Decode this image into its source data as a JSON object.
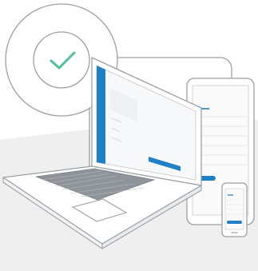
{
  "illustration": {
    "status": {
      "icon": "check-icon",
      "state": "success"
    },
    "devices": [
      "laptop",
      "tablet",
      "phone"
    ]
  },
  "colors": {
    "accent": "#1f7fc7",
    "check": "#4cbf9b",
    "outline": "#9aa0a6",
    "floor": "#eeeeee",
    "panel": "#f5f6f7",
    "keys": "#8e9499"
  }
}
